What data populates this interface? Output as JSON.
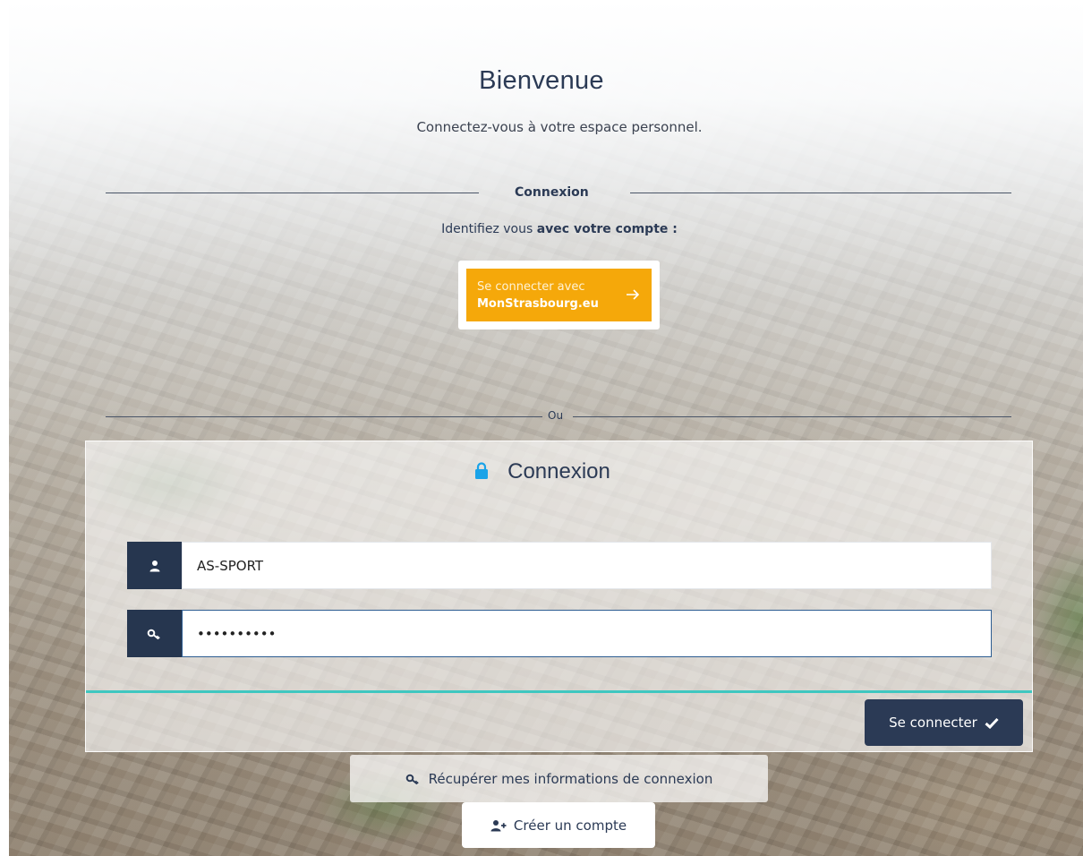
{
  "header": {
    "title": "Bienvenue",
    "subtitle": "Connectez-vous à votre espace personnel."
  },
  "sso_section": {
    "label": "Connexion",
    "identify_prefix": "Identifiez vous ",
    "identify_bold": "avec votre compte :",
    "sso_button": {
      "line1": "Se connecter avec",
      "line2": "MonStrasbourg.eu"
    }
  },
  "separator": {
    "label": "Ou"
  },
  "login_panel": {
    "title": "Connexion",
    "username": {
      "value": "AS-SPORT",
      "icon": "user-icon"
    },
    "password": {
      "value": "••••••••••",
      "icon": "key-icon"
    },
    "submit_label": "Se connecter",
    "submit_icon": "check-icon"
  },
  "links": {
    "recover_label": "Récupérer mes informations de connexion",
    "recover_icon": "key-icon",
    "create_label": "Créer un compte",
    "create_icon": "user-plus-icon"
  },
  "colors": {
    "navy": "#2b3a55",
    "sso_orange": "#f5a80a",
    "lock_blue": "#1aa3e8",
    "teal": "#3fc7c0"
  }
}
